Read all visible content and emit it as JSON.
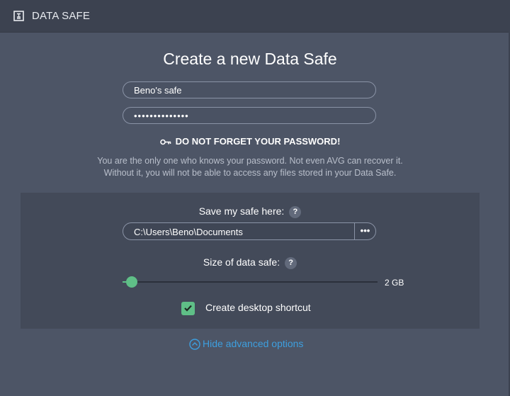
{
  "titlebar": {
    "title": "DATA SAFE",
    "icon": "data-safe-icon"
  },
  "form": {
    "heading": "Create a new Data Safe",
    "name_value": "Beno's safe",
    "password_value": "••••••••••••••"
  },
  "warning": {
    "title": "DO NOT FORGET YOUR PASSWORD!",
    "icon": "key-icon",
    "line1": "You are the only one who knows your password. Not even AVG can recover it.",
    "line2": "Without it, you will not be able to access any files stored in your Data Safe."
  },
  "advanced": {
    "location_label": "Save my safe here:",
    "location_value": "C:\\Users\\Beno\\Documents",
    "browse_label": "•••",
    "help_label": "?",
    "size_label": "Size of data safe:",
    "size_value_text": "2 GB",
    "size_fraction": 0.02,
    "shortcut_label": "Create desktop shortcut",
    "shortcut_checked": true
  },
  "link": {
    "hide_advanced": "Hide advanced options"
  },
  "colors": {
    "accent_green": "#5fbf87",
    "link_blue": "#3d9fdf",
    "background": "#4d5566",
    "titlebar": "#3c4250"
  }
}
